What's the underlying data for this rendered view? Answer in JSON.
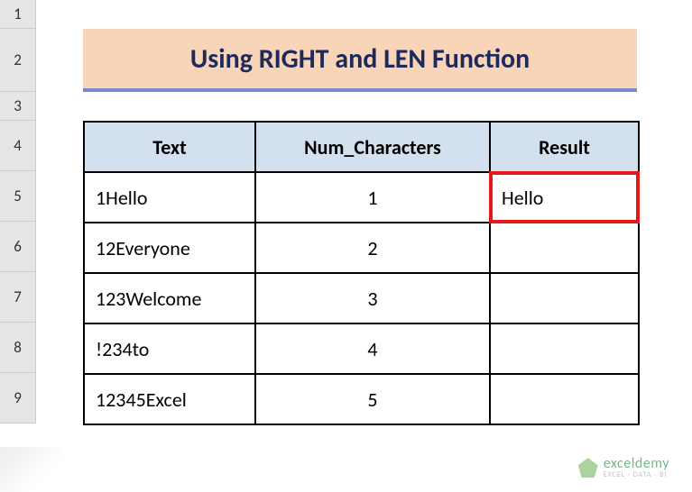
{
  "rows": [
    "1",
    "2",
    "3",
    "4",
    "5",
    "6",
    "7",
    "8",
    "9"
  ],
  "title": "Using RIGHT and LEN Function",
  "headers": {
    "text": "Text",
    "num": "Num_Characters",
    "result": "Result"
  },
  "data": [
    {
      "text": "1Hello",
      "num": "1",
      "result": "Hello"
    },
    {
      "text": "12Everyone",
      "num": "2",
      "result": ""
    },
    {
      "text": "123Welcome",
      "num": "3",
      "result": ""
    },
    {
      "text": "!234to",
      "num": "4",
      "result": ""
    },
    {
      "text": "12345Excel",
      "num": "5",
      "result": ""
    }
  ],
  "watermark": {
    "main": "exceldemy",
    "sub": "EXCEL · DATA · BI"
  },
  "chart_data": {
    "type": "table",
    "title": "Using RIGHT and LEN Function",
    "columns": [
      "Text",
      "Num_Characters",
      "Result"
    ],
    "rows": [
      [
        "1Hello",
        1,
        "Hello"
      ],
      [
        "12Everyone",
        2,
        ""
      ],
      [
        "123Welcome",
        3,
        ""
      ],
      [
        "!234to",
        4,
        ""
      ],
      [
        "12345Excel",
        5,
        ""
      ]
    ]
  }
}
